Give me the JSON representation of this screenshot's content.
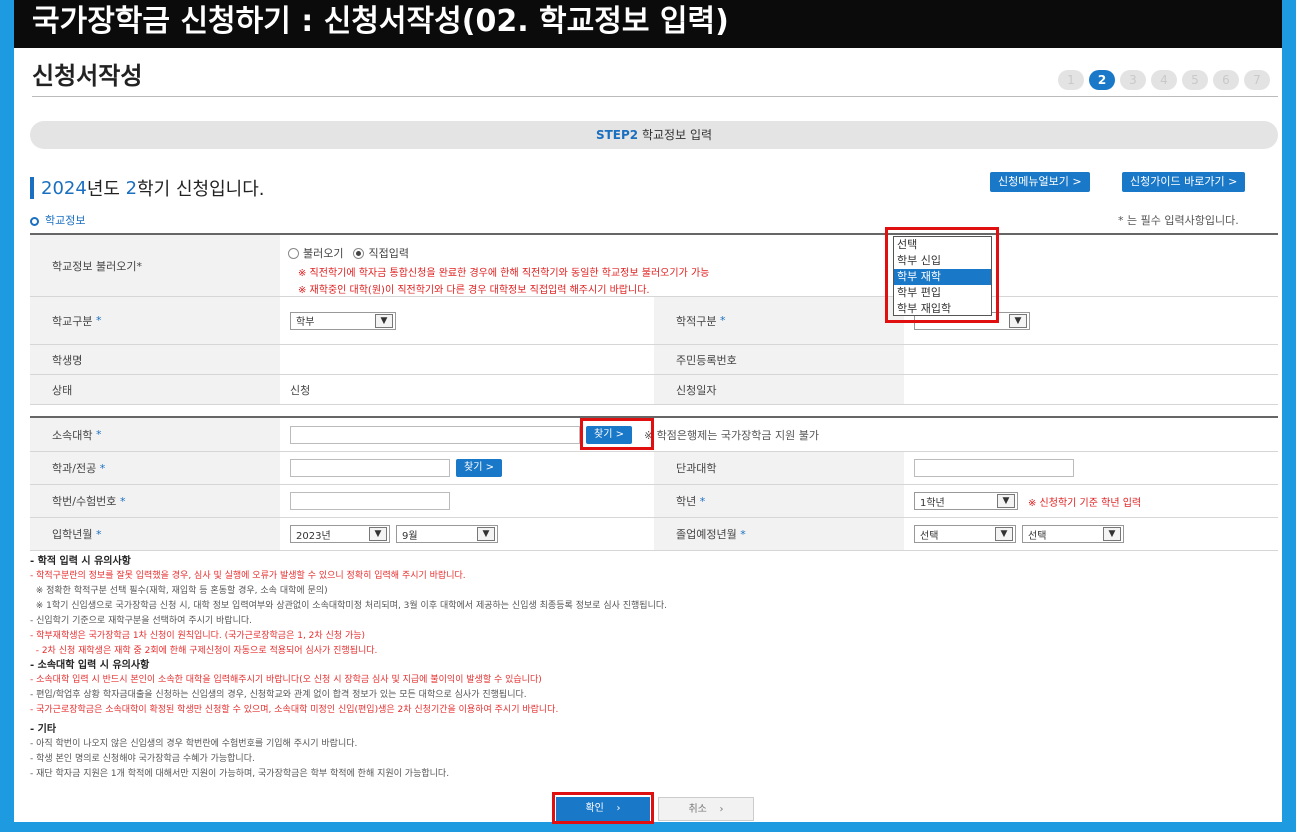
{
  "banner": "국가장학금 신청하기 : 신청서작성(02. 학교정보 입력)",
  "page_title": "신청서작성",
  "steps": [
    "1",
    "2",
    "3",
    "4",
    "5",
    "6",
    "7"
  ],
  "step_bar": {
    "step": "STEP2",
    "label": "학교정보 입력"
  },
  "semester": {
    "year": "2024",
    "t1": "년도 ",
    "term": "2",
    "t2": "학기 신청입니다."
  },
  "buttons": {
    "manual": "신청메뉴얼보기 >",
    "guide": "신청가이드 바로가기 >",
    "find": "찾기 >",
    "find2": "찾기 >",
    "confirm": "확인",
    "cancel": "취소"
  },
  "section": "학교정보",
  "required_note": "* 는 필수 입력사항입니다.",
  "school_load": {
    "label": "학교정보 불러오기*",
    "radio1": "불러오기",
    "radio2": "직접입력",
    "note1": "※ 직전학기에 학자금 통합신청을 완료한 경우에 한해 직전학기와 동일한 학교정보 불러오기가 가능",
    "note2": "※ 재학중인 대학(원)이 직전학기와 다른 경우 대학정보 직접입력 해주시기 바랍니다."
  },
  "school_type": {
    "label": "학교구분",
    "value": "학부"
  },
  "academic_type": {
    "label": "학적구분"
  },
  "student_name": {
    "label": "학생명"
  },
  "resident_no": {
    "label": "주민등록번호"
  },
  "status": {
    "label": "상태",
    "value": "신청"
  },
  "apply_date": {
    "label": "신청일자"
  },
  "university": {
    "label": "소속대학",
    "note": "※ 학점은행제는 국가장학금 지원 불가"
  },
  "dept": {
    "label": "학과/전공"
  },
  "college": {
    "label": "단과대학"
  },
  "student_id": {
    "label": "학번/수험번호"
  },
  "grade": {
    "label": "학년",
    "value": "1학년",
    "note": "※ 신청학기 기준 학년 입력"
  },
  "admission": {
    "label": "입학년월",
    "year": "2023년",
    "month": "9월"
  },
  "graduation": {
    "label": "졸업예정년월",
    "year": "선택",
    "month": "선택"
  },
  "dropdown_options": [
    "선택",
    "학부 신입",
    "학부 재학",
    "학부 편입",
    "학부 재입학"
  ],
  "dropdown_selected": "학부 재학",
  "notes": {
    "h1": "- 학적 입력 시 유의사항",
    "n1": [
      "- 학적구분란의 정보를 잘못 입력했을 경우, 심사 및 실행에 오류가 발생할 수 있으니 정확히 입력해 주시기 바랍니다.",
      "  ※ 정확한 학적구분 선택 필수(재학, 재입학 등 혼동할 경우, 소속 대학에 문의)",
      "  ※ 1학기 신입생으로 국가장학금 신청 시, 대학 정보 입력여부와 상관없이 소속대학미정 처리되며, 3월 이후 대학에서 제공하는 신입생 최종등록 정보로 심사 진행됩니다.",
      "- 신입학기 기준으로 재학구분을 선택하여 주시기 바랍니다.",
      "- 학부재학생은 국가장학금 1차 신청이 원칙입니다. (국가근로장학금은 1, 2차 신청 가능)",
      "  - 2차 신청 재학생은 재학 중 2회에 한해 구제신청이 자동으로 적용되어 심사가 진행됩니다."
    ],
    "h2": "- 소속대학 입력 시 유의사항",
    "n2": [
      "- 소속대학 입력 시 반드시 본인이 소속한 대학을 입력해주시기 바랍니다(오 신청 시 장학금 심사 및 지급에 불이익이 발생할 수 있습니다)",
      "- 편입/학업후 상황 학자금대출을 신청하는 신입생의 경우, 신청학교와 관계 없이 합격 정보가 있는 모든 대학으로 심사가 진행됩니다.",
      "- 국가근로장학금은 소속대학이 확정된 학생만 신청할 수 있으며, 소속대학 미정인 신입(편입)생은 2차 신청기간을 이용하여 주시기 바랍니다."
    ],
    "h3": "- 기타",
    "n3": [
      "- 아직 학번이 나오지 않은 신입생의 경우 학번란에 수험번호를 기입해 주시기 바랍니다.",
      "- 학생 본인 명의로 신청해야 국가장학금 수혜가 가능합니다.",
      "- 재단 학자금 지원은 1개 학적에 대해서만 지원이 가능하며, 국가장학금은 학부 학적에 한해 지원이 가능합니다."
    ]
  }
}
